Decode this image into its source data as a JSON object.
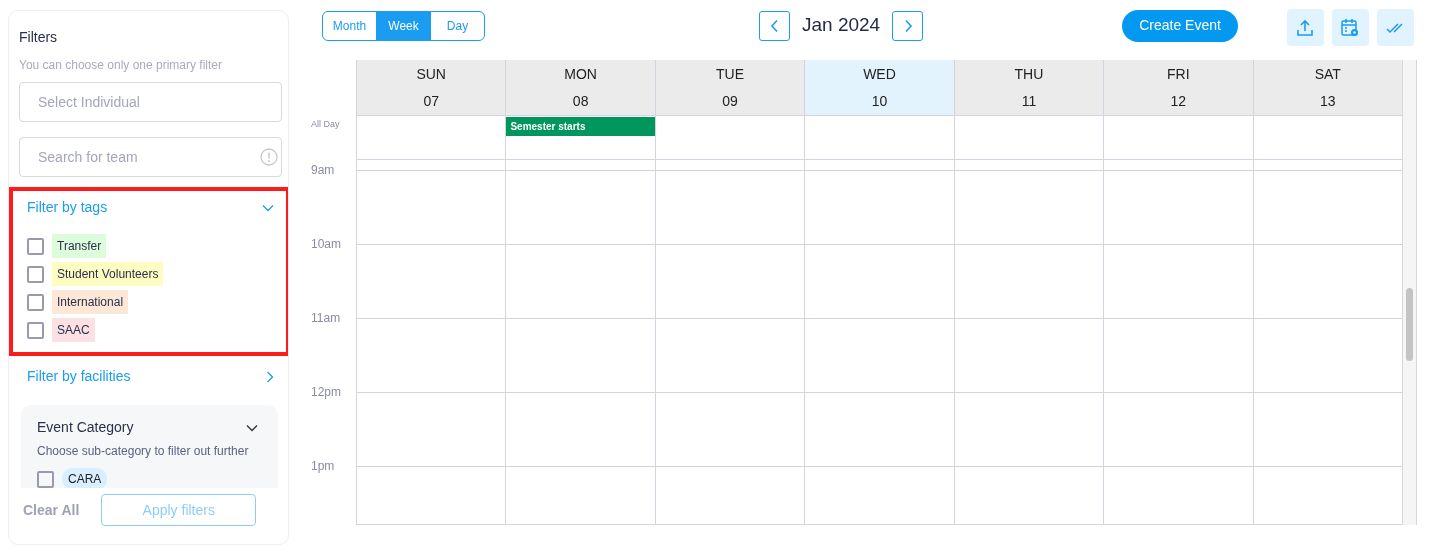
{
  "filters": {
    "title": "Filters",
    "hint": "You can choose only one primary filter",
    "individual": {
      "placeholder": "Select Individual"
    },
    "team": {
      "placeholder": "Search for team"
    },
    "tags": {
      "title": "Filter by tags",
      "expanded": true,
      "highlighted": true,
      "items": [
        {
          "label": "Transfer",
          "checked": false,
          "color": "#dcfcdc"
        },
        {
          "label": "Student Volunteers",
          "checked": false,
          "color": "#fdfdc2"
        },
        {
          "label": "International",
          "checked": false,
          "color": "#fde8d8"
        },
        {
          "label": "SAAC",
          "checked": false,
          "color": "#fde0e3"
        }
      ]
    },
    "facilities": {
      "title": "Filter by facilities",
      "expanded": false
    },
    "event_category": {
      "title": "Event Category",
      "hint": "Choose sub-category to filter out further",
      "expanded": true,
      "items": [
        {
          "label": "CARA",
          "checked": false
        }
      ]
    },
    "clear": "Clear All",
    "apply": {
      "label": "Apply filters",
      "disabled": true
    }
  },
  "toolbar": {
    "views": [
      {
        "label": "Month",
        "selected": false
      },
      {
        "label": "Week",
        "selected": true
      },
      {
        "label": "Day",
        "selected": false
      }
    ],
    "period": "Jan 2024",
    "create": "Create Event"
  },
  "calendar": {
    "all_day_label": "All Day",
    "days": [
      {
        "weekday": "SUN",
        "date": "07",
        "today": false
      },
      {
        "weekday": "MON",
        "date": "08",
        "today": false,
        "events": [
          {
            "title": "Semester starts",
            "color": "#00965e"
          }
        ]
      },
      {
        "weekday": "TUE",
        "date": "09",
        "today": false
      },
      {
        "weekday": "WED",
        "date": "10",
        "today": true
      },
      {
        "weekday": "THU",
        "date": "11",
        "today": false
      },
      {
        "weekday": "FRI",
        "date": "12",
        "today": false
      },
      {
        "weekday": "SAT",
        "date": "13",
        "today": false
      }
    ],
    "hours": [
      "9am",
      "10am",
      "11am",
      "12pm",
      "1pm"
    ]
  }
}
